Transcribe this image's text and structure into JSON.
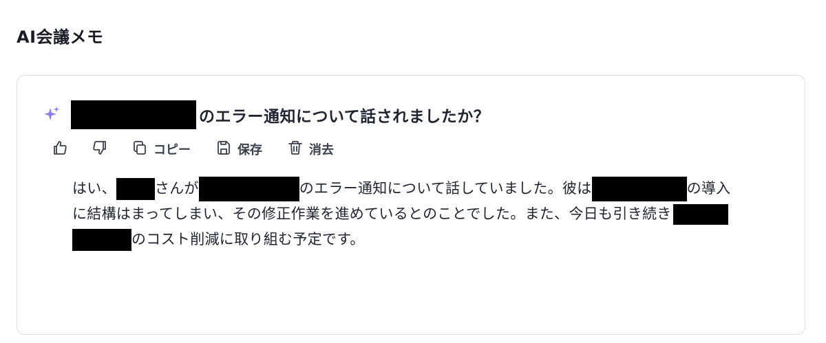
{
  "page": {
    "title": "AI会議メモ"
  },
  "card": {
    "question_text": "のエラー通知について話されましたか？",
    "icons": {
      "sparkle": "sparkle-icon",
      "like": "thumbs-up-icon",
      "dislike": "thumbs-down-icon",
      "copy": "copy-icon",
      "save": "save-icon",
      "delete": "trash-icon"
    },
    "toolbar": {
      "copy_label": "コピー",
      "save_label": "保存",
      "delete_label": "消去"
    },
    "answer": {
      "seg1": "はい、",
      "seg2": "さんが",
      "seg3": "のエラー通知について話していました。彼は",
      "seg4": "の導入",
      "seg5": "に結構はまってしまい、その修正作業を進めているとのことでした。また、今日も引き続き",
      "seg6": "のコスト削減に取り組む予定です。"
    },
    "colors": {
      "accent_sparkle": "#8b7cf6",
      "border": "#dcdfe5",
      "redaction": "#000000"
    }
  }
}
